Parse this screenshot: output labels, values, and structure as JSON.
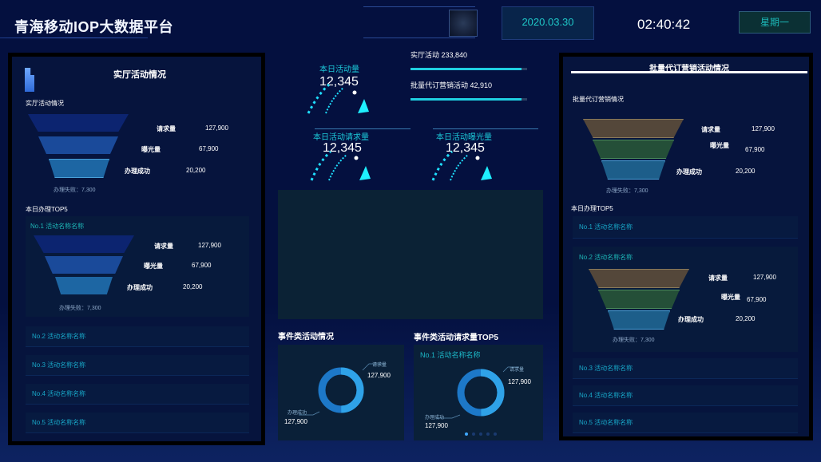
{
  "header": {
    "title": "青海移动IOP大数据平台",
    "date": "2020.03.30",
    "time": "02:40:42",
    "weekday": "星期一"
  },
  "left_panel": {
    "title": "实厅活动情况",
    "section_label": "实厅活动情况",
    "funnel": {
      "request_label": "请求量",
      "request_value": "127,900",
      "exposure_label": "曝光量",
      "exposure_value": "67,900",
      "success_label": "办理成功",
      "success_value": "20,200",
      "fail_label": "办理失败：7,300"
    },
    "top5_label": "本日办理TOP5",
    "top_items": [
      {
        "name": "No.1 活动名称名称"
      },
      {
        "name": "No.2 活动名称名称"
      },
      {
        "name": "No.3 活动名称名称"
      },
      {
        "name": "No.4 活动名称名称"
      },
      {
        "name": "No.5 活动名称名称"
      }
    ],
    "top1_funnel": {
      "request_label": "请求量",
      "request_value": "127,900",
      "exposure_label": "曝光量",
      "exposure_value": "67,900",
      "success_label": "办理成功",
      "success_value": "20,200",
      "fail_label": "办理失败：7,300"
    }
  },
  "center": {
    "gauge1_label": "本日活动量",
    "gauge1_value": "12,345",
    "gauge2_label": "本日活动请求量",
    "gauge2_value": "12,345",
    "gauge3_label": "本日活动曝光量",
    "gauge3_value": "12,345",
    "stat1_label": "实厅活动 233,840",
    "stat2_label": "批量代订营销活动 42,910",
    "stat1_fill": 0.95,
    "stat2_fill": 0.95,
    "event_title": "事件类活动情况",
    "event_top_title": "事件类活动请求量TOP5",
    "event_top_item": "No.1 活动名称名称",
    "ring1": {
      "top_value": "127,900",
      "bottom_value": "127,900",
      "top_small": "请求量",
      "bottom_small": "办理成功"
    },
    "ring2": {
      "top_value": "127,900",
      "bottom_value": "127,900",
      "top_small": "请求量",
      "bottom_small": "办理成功"
    }
  },
  "right_panel": {
    "title": "批量代订营销活动情况",
    "section_label": "批量代订营销情况",
    "funnel": {
      "request_label": "请求量",
      "request_value": "127,900",
      "exposure_label": "曝光量",
      "exposure_value": "67,900",
      "success_label": "办理成功",
      "success_value": "20,200",
      "fail_label": "办理失败：7,300"
    },
    "top5_label": "本日办理TOP5",
    "top_items": [
      {
        "name": "No.1 活动名称名称"
      },
      {
        "name": "No.2 活动名称名称"
      },
      {
        "name": "No.3 活动名称名称"
      },
      {
        "name": "No.4 活动名称名称"
      },
      {
        "name": "No.5 活动名称名称"
      }
    ],
    "top2_funnel": {
      "request_label": "请求量",
      "request_value": "127,900",
      "exposure_label": "曝光量",
      "exposure_value": "67,900",
      "success_label": "办理成功",
      "success_value": "20,200",
      "fail_label": "办理失败：7,300"
    }
  },
  "colors": {
    "accent": "#1fcfe0",
    "gauge": "#1fdfff",
    "funnel_blue_1": "#0d2a73",
    "funnel_blue_2": "#1a4aa0",
    "funnel_blue_3": "#1e6aa8",
    "funnel_brown": "#5a4b3a",
    "funnel_green": "#2a5a3e",
    "funnel_teal": "#1d5e8a"
  }
}
